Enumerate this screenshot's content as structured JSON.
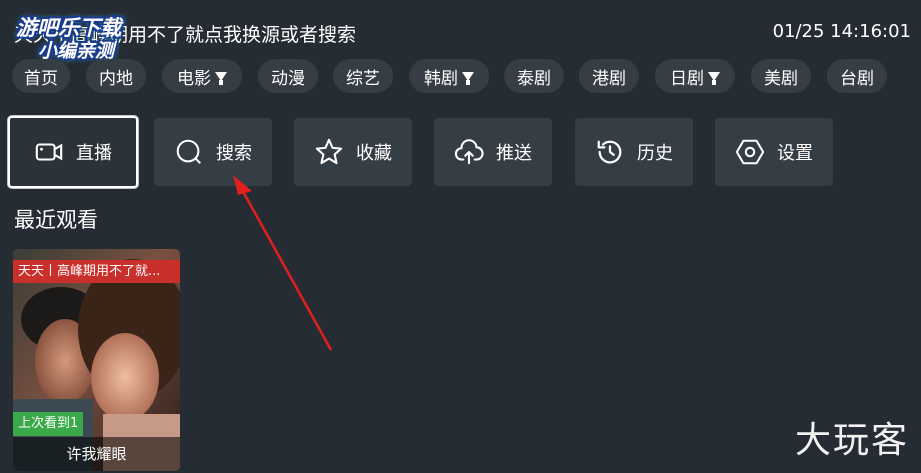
{
  "header": {
    "notice": "天天丨高峰期用不了就点我换源或者搜索",
    "datetime": "01/25 14:16:01"
  },
  "overlay": {
    "line1": "游吧乐下载",
    "line2": "小编亲测"
  },
  "categories": [
    {
      "label": "首页",
      "filter": false
    },
    {
      "label": "内地",
      "filter": false
    },
    {
      "label": "电影",
      "filter": true
    },
    {
      "label": "动漫",
      "filter": false
    },
    {
      "label": "综艺",
      "filter": false
    },
    {
      "label": "韩剧",
      "filter": true
    },
    {
      "label": "泰剧",
      "filter": false
    },
    {
      "label": "港剧",
      "filter": false
    },
    {
      "label": "日剧",
      "filter": true
    },
    {
      "label": "美剧",
      "filter": false
    },
    {
      "label": "台剧",
      "filter": false
    }
  ],
  "tiles": [
    {
      "label": "直播",
      "icon": "video-camera-icon",
      "active": true
    },
    {
      "label": "搜索",
      "icon": "search-icon",
      "active": false
    },
    {
      "label": "收藏",
      "icon": "star-icon",
      "active": false
    },
    {
      "label": "推送",
      "icon": "cloud-upload-icon",
      "active": false
    },
    {
      "label": "历史",
      "icon": "history-icon",
      "active": false
    },
    {
      "label": "设置",
      "icon": "settings-hexagon-icon",
      "active": false
    }
  ],
  "recent": {
    "title": "最近观看",
    "items": [
      {
        "badge": "天天丨高峰期用不了就...",
        "progress": "上次看到1",
        "title": "许我耀眼"
      }
    ]
  },
  "watermark": "大玩客",
  "colors": {
    "background": "#262c33",
    "chip": "#363d45",
    "tile": "#353d45",
    "badge": "#c9302c",
    "progress": "#3aa94a",
    "arrow": "#e0201f"
  }
}
